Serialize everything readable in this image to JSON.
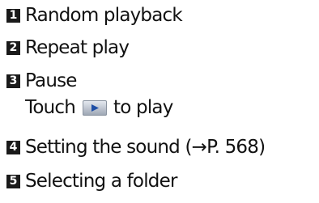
{
  "items": [
    {
      "number": "1",
      "label": "Random playback"
    },
    {
      "number": "2",
      "label": "Repeat play"
    },
    {
      "number": "3",
      "label": "Pause"
    },
    {
      "number": "4",
      "label": "Setting the sound (→P. 568)"
    },
    {
      "number": "5",
      "label": "Selecting a folder"
    }
  ],
  "pause_note": {
    "before": "Touch",
    "after": "to play"
  },
  "colors": {
    "text": "#111111",
    "number_badge": "#1a1a1a",
    "play_icon": "#1f4fa6"
  }
}
